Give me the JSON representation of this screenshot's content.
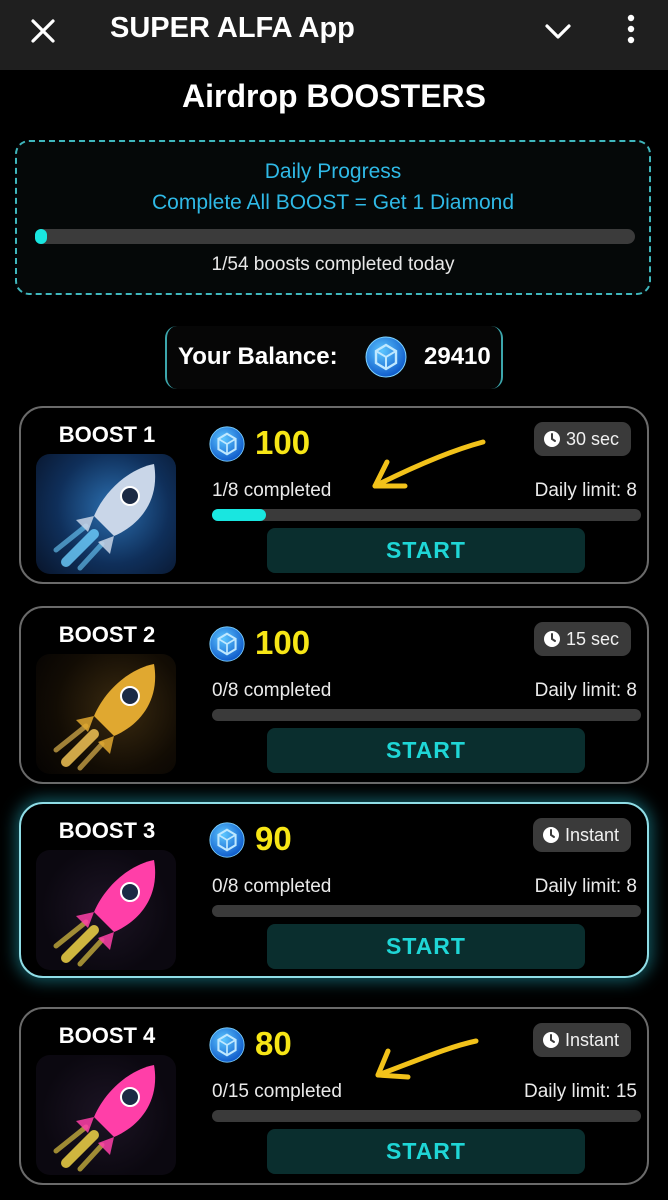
{
  "header": {
    "title": "SUPER ALFA App"
  },
  "page": {
    "title": "Airdrop BOOSTERS"
  },
  "daily_progress": {
    "title": "Daily Progress",
    "subtitle": "Complete All BOOST = Get 1 Diamond",
    "completed": 1,
    "total": 54,
    "caption": "1/54 boosts completed today"
  },
  "balance": {
    "label": "Your Balance:",
    "value": "29410"
  },
  "boosts": [
    {
      "title": "BOOST 1",
      "reward": "100",
      "time": "30 sec",
      "completed_text": "1/8 completed",
      "limit_text": "Daily limit: 8",
      "progress": 0.125,
      "button": "START"
    },
    {
      "title": "BOOST 2",
      "reward": "100",
      "time": "15 sec",
      "completed_text": "0/8 completed",
      "limit_text": "Daily limit: 8",
      "progress": 0,
      "button": "START"
    },
    {
      "title": "BOOST 3",
      "reward": "90",
      "time": "Instant",
      "completed_text": "0/8 completed",
      "limit_text": "Daily limit: 8",
      "progress": 0,
      "button": "START"
    },
    {
      "title": "BOOST 4",
      "reward": "80",
      "time": "Instant",
      "completed_text": "0/15 completed",
      "limit_text": "Daily limit: 15",
      "progress": 0,
      "button": "START"
    }
  ],
  "colors": {
    "accent_cyan": "#19e6e0",
    "reward_yellow": "#f7e616",
    "progress_text_blue": "#2fb9e6",
    "annotation_arrow": "#f2c21a"
  },
  "icons": [
    "close-icon",
    "chevron-down-icon",
    "more-vertical-icon",
    "coin-icon",
    "clock-icon",
    "rocket-image"
  ]
}
